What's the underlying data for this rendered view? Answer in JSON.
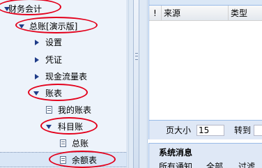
{
  "nav": {
    "items": [
      {
        "label": "财务会计"
      },
      {
        "label": "总账[演示版]"
      },
      {
        "label": "设置"
      },
      {
        "label": "凭证"
      },
      {
        "label": "现金流量表"
      },
      {
        "label": "账表"
      },
      {
        "label": "我的账表"
      },
      {
        "label": "科目账"
      },
      {
        "label": "总账"
      },
      {
        "label": "余额表"
      }
    ]
  },
  "grid": {
    "col_flag": "!",
    "col_source": "来源",
    "col_type": "类型"
  },
  "pager": {
    "page_size_label": "页大小",
    "page_size_value": "15",
    "goto_label": "转到"
  },
  "messages": {
    "title": "系统消息",
    "tabs": [
      "所有通知",
      "全部",
      "过滤"
    ]
  },
  "colors": {
    "highlight": "#e3001b",
    "nav_bg": "#edf3fb",
    "panel_bg": "#dfe8f6",
    "arrow": "#1f3c88"
  }
}
